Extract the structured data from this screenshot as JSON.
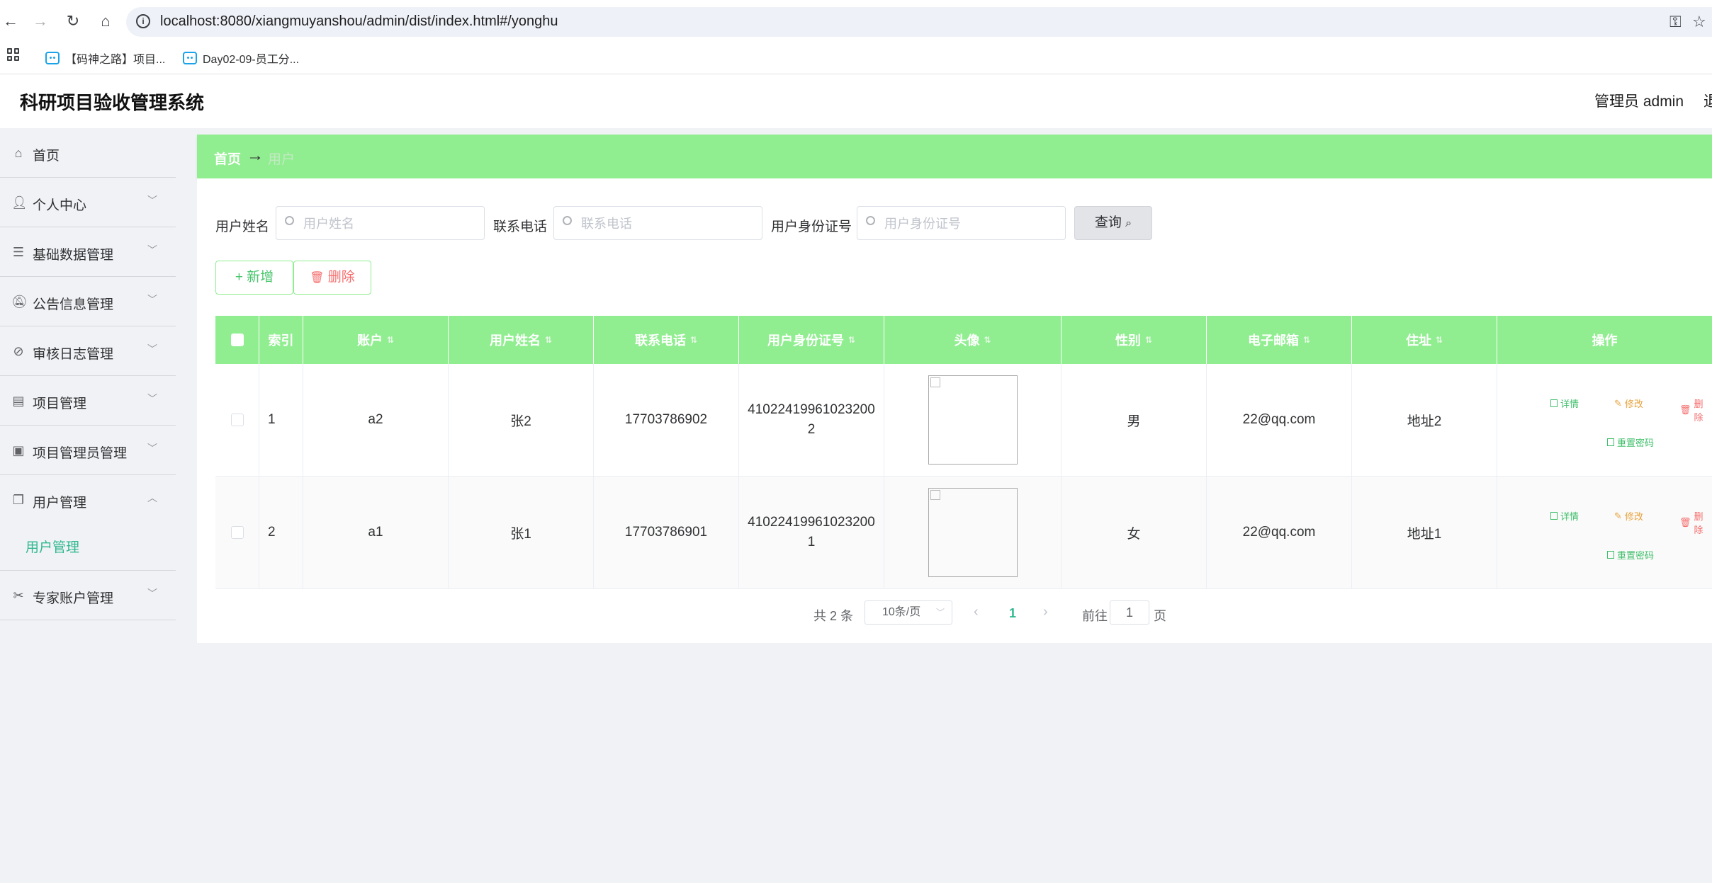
{
  "browser": {
    "url": "localhost:8080/xiangmuyanshou/admin/dist/index.html#/yonghu",
    "bookmarks": [
      "【码神之路】项目...",
      "Day02-09-员工分..."
    ]
  },
  "header": {
    "title": "科研项目验收管理系统",
    "user": "管理员 admin",
    "logout": "退"
  },
  "sidebar": {
    "items": [
      {
        "label": "首页",
        "icon": "home-icon",
        "arrow": ""
      },
      {
        "label": "个人中心",
        "icon": "user-icon",
        "arrow": "﹀"
      },
      {
        "label": "基础数据管理",
        "icon": "list-icon",
        "arrow": "﹀"
      },
      {
        "label": "公告信息管理",
        "icon": "bell-off-icon",
        "arrow": "﹀"
      },
      {
        "label": "审核日志管理",
        "icon": "compass-icon",
        "arrow": "﹀"
      },
      {
        "label": "项目管理",
        "icon": "briefcase-icon",
        "arrow": "﹀"
      },
      {
        "label": "项目管理员管理",
        "icon": "wallet-icon",
        "arrow": "﹀"
      },
      {
        "label": "用户管理",
        "icon": "copy-icon",
        "arrow": "︿"
      },
      {
        "label": "专家账户管理",
        "icon": "ticket-icon",
        "arrow": "﹀"
      }
    ],
    "submenu_label": "用户管理"
  },
  "breadcrumb": {
    "home": "首页",
    "separator": "→",
    "current": "用户"
  },
  "search": {
    "name_label": "用户姓名",
    "name_placeholder": "用户姓名",
    "phone_label": "联系电话",
    "phone_placeholder": "联系电话",
    "id_label": "用户身份证号",
    "id_placeholder": "用户身份证号",
    "query_label": "查询"
  },
  "actions": {
    "add_label": "+ 新增",
    "delete_label": "删除"
  },
  "table": {
    "columns": [
      "索引",
      "账户",
      "用户姓名",
      "联系电话",
      "用户身份证号",
      "头像",
      "性别",
      "电子邮箱",
      "住址",
      "操作"
    ],
    "rows": [
      {
        "index": "1",
        "account": "a2",
        "name": "张2",
        "phone": "17703786902",
        "id_line1": "41022419961023200",
        "id_line2": "2",
        "gender": "男",
        "email": "22@qq.com",
        "address": "地址2"
      },
      {
        "index": "2",
        "account": "a1",
        "name": "张1",
        "phone": "17703786901",
        "id_line1": "41022419961023200",
        "id_line2": "1",
        "gender": "女",
        "email": "22@qq.com",
        "address": "地址1"
      }
    ],
    "op_labels": {
      "detail": "详情",
      "edit": "修改",
      "remove": "删除",
      "reset": "重置密码"
    }
  },
  "pagination": {
    "total": "共 2 条",
    "page_size": "10条/页",
    "current": "1",
    "goto_prefix": "前往",
    "goto_value": "1",
    "goto_suffix": "页"
  }
}
